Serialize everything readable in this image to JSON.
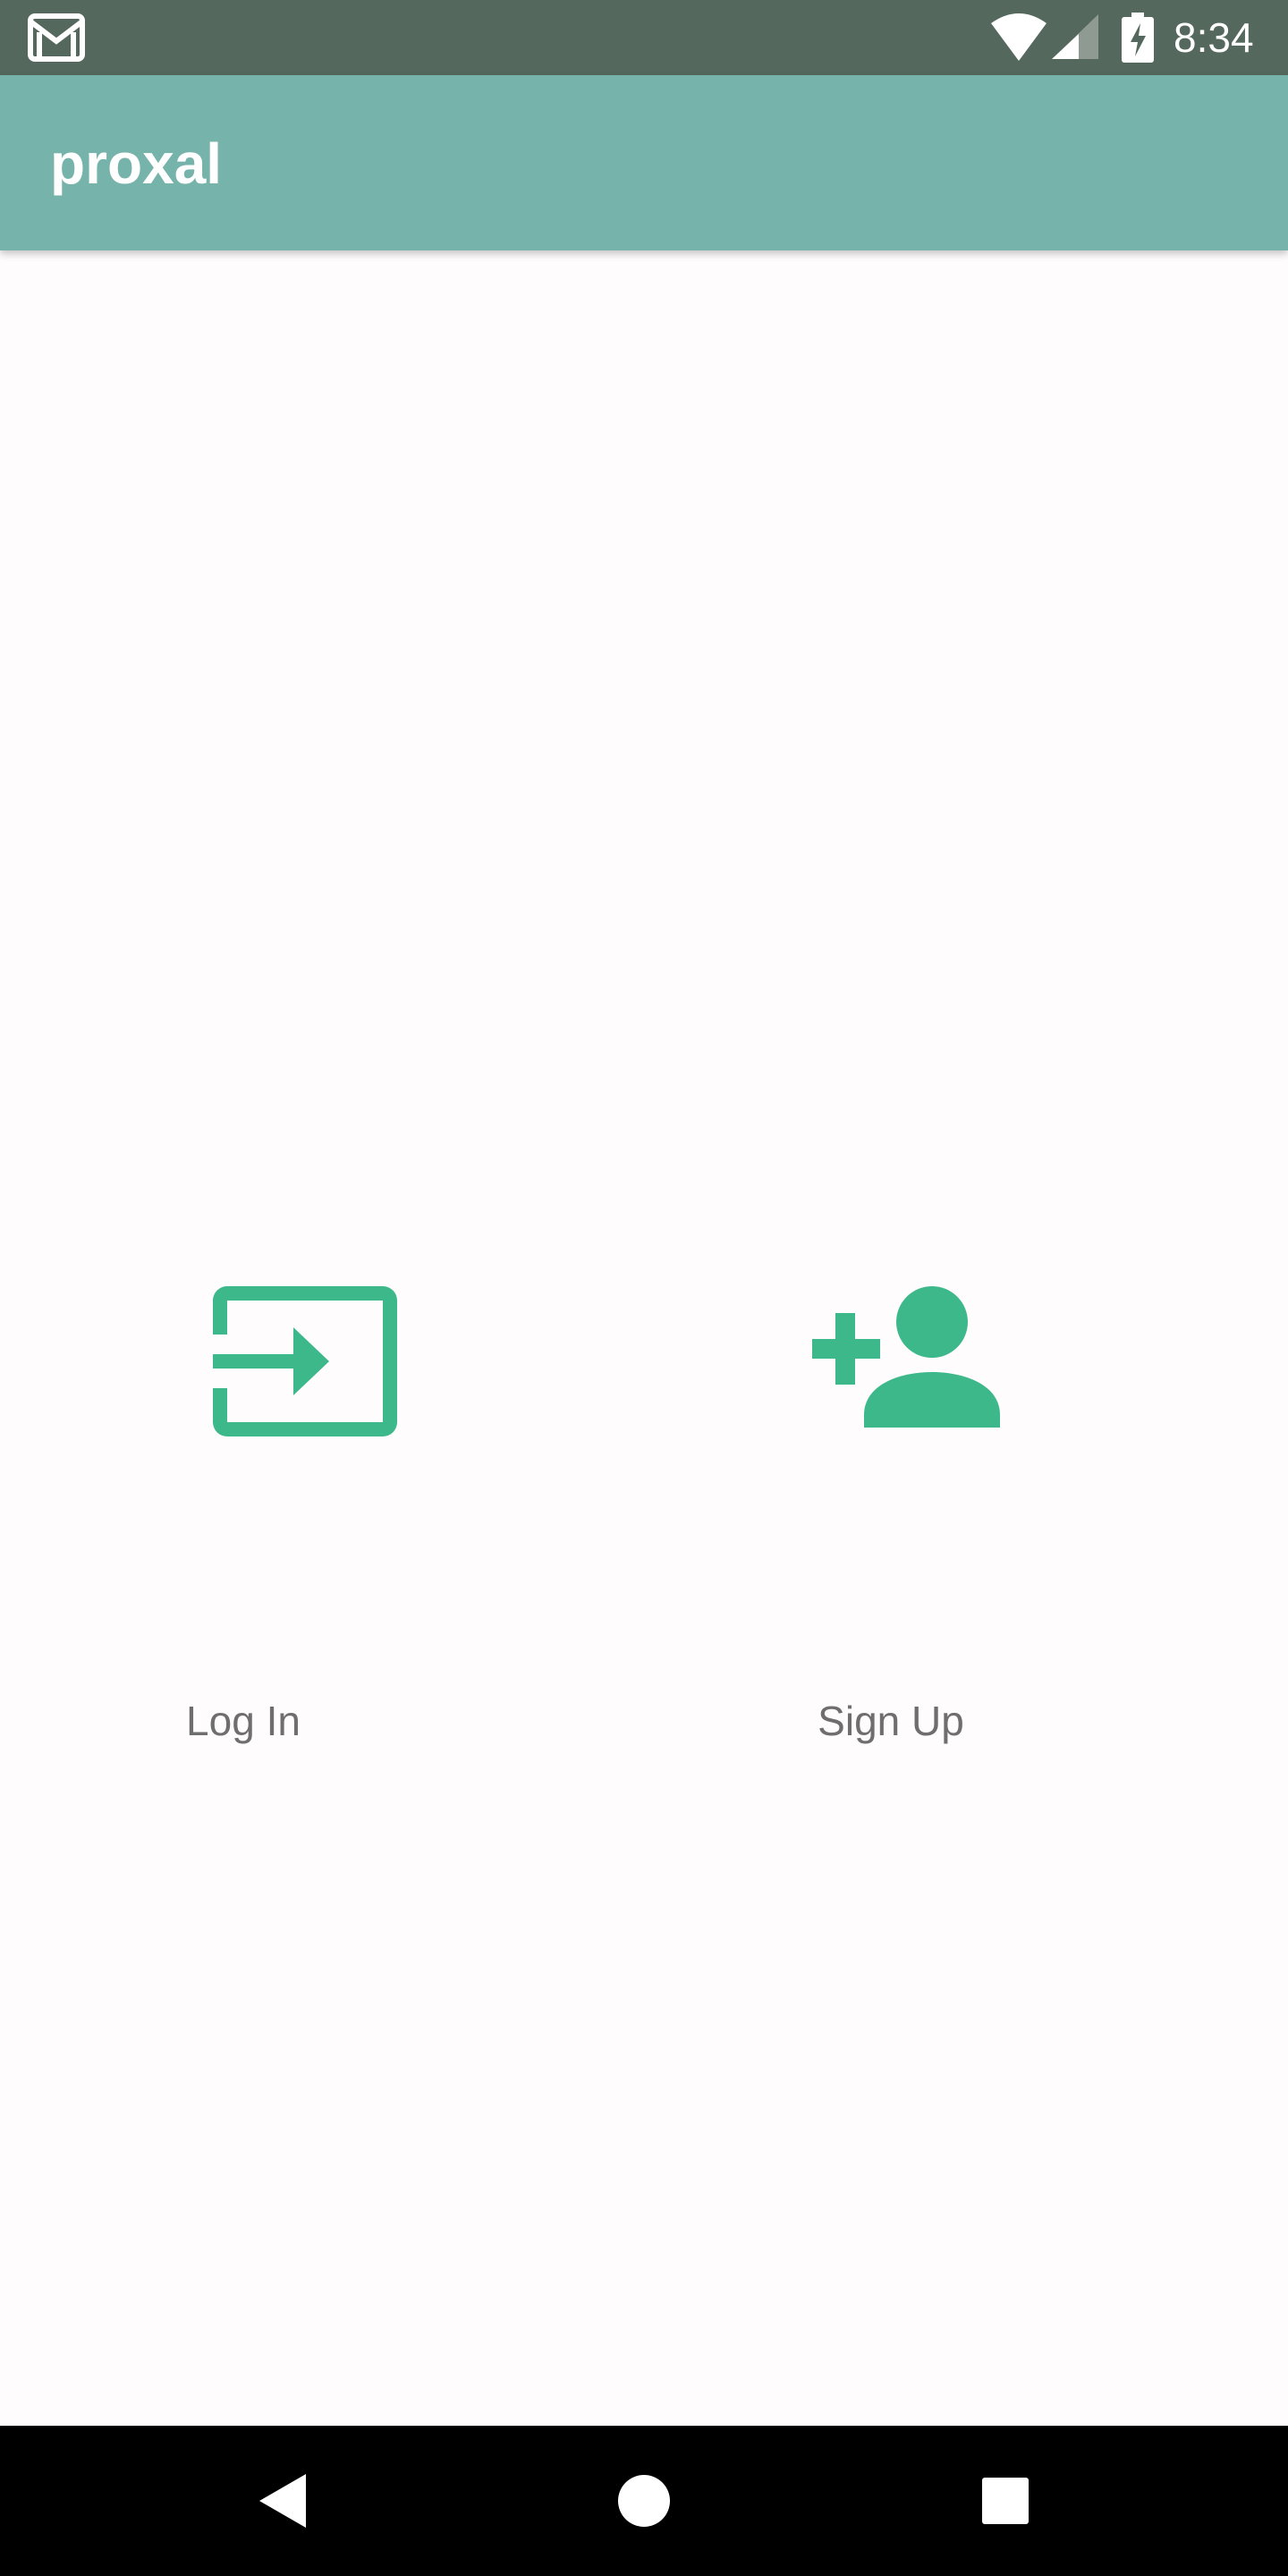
{
  "status_bar": {
    "time": "8:34",
    "notification_icon": "gmail-icon",
    "icons": [
      "wifi-icon",
      "cell-signal-icon",
      "battery-charging-icon"
    ]
  },
  "app_bar": {
    "title": "proxal",
    "color": "#76b3ab"
  },
  "actions": {
    "login": {
      "label": "Log In",
      "icon": "login-icon"
    },
    "signup": {
      "label": "Sign Up",
      "icon": "person-add-icon"
    }
  },
  "accent_color": "#3db88b",
  "nav_bar": {
    "buttons": [
      "back-icon",
      "home-icon",
      "recents-icon"
    ]
  }
}
